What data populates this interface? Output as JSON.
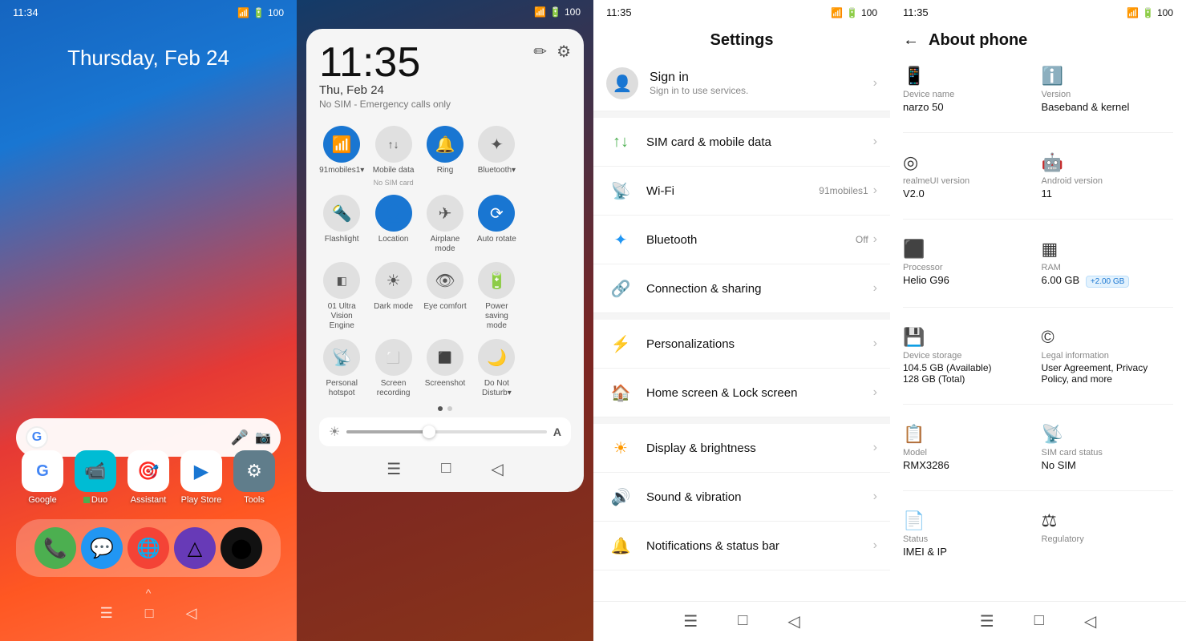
{
  "screen1": {
    "status_time": "11:34",
    "status_icons": "📶 🔋 100",
    "date": "Thursday, Feb 24",
    "apps": [
      {
        "label": "Google",
        "icon": "G",
        "bg": "#fff",
        "color": "#4285f4"
      },
      {
        "label": "Duo",
        "icon": "📹",
        "bg": "#00bcd4",
        "color": "white"
      },
      {
        "label": "Assistant",
        "icon": "◉",
        "bg": "#fff",
        "color": "#4285f4"
      },
      {
        "label": "Play Store",
        "icon": "▶",
        "bg": "#fff",
        "color": "#1976d2"
      },
      {
        "label": "Tools",
        "icon": "⚙",
        "bg": "#607d8b",
        "color": "white"
      }
    ],
    "dock": [
      {
        "icon": "📞",
        "bg": "#4caf50"
      },
      {
        "icon": "💬",
        "bg": "#2196f3"
      },
      {
        "icon": "🌐",
        "bg": "#f44336"
      },
      {
        "icon": "△",
        "bg": "#673ab7"
      },
      {
        "icon": "⬤",
        "bg": "#111"
      }
    ],
    "nav": [
      "☰",
      "□",
      "◁"
    ]
  },
  "screen2": {
    "status_time": "",
    "shade_time": "11:35",
    "shade_date": "Thu, Feb 24",
    "shade_sim": "No SIM - Emergency calls only",
    "tiles_row1": [
      {
        "label": "91mobiles1▾",
        "sublabel": "",
        "icon": "📶",
        "active": true
      },
      {
        "label": "Mobile data",
        "sublabel": "No SIM card",
        "icon": "↑↓",
        "active": false
      },
      {
        "label": "Ring",
        "sublabel": "",
        "icon": "🔔",
        "active": true
      },
      {
        "label": "Bluetooth▾",
        "sublabel": "",
        "icon": "✦",
        "active": false
      }
    ],
    "tiles_row2": [
      {
        "label": "Flashlight",
        "sublabel": "",
        "icon": "🔦",
        "active": false
      },
      {
        "label": "Location",
        "sublabel": "",
        "icon": "👤",
        "active": true
      },
      {
        "label": "Airplane mode",
        "sublabel": "",
        "icon": "✈",
        "active": false
      },
      {
        "label": "Auto rotate",
        "sublabel": "",
        "icon": "⟳",
        "active": true
      }
    ],
    "tiles_row3": [
      {
        "label": "01 Ultra Vision Engine",
        "sublabel": "",
        "icon": "◧",
        "active": false
      },
      {
        "label": "Dark mode",
        "sublabel": "",
        "icon": "☀",
        "active": false
      },
      {
        "label": "Eye comfort",
        "sublabel": "",
        "icon": "👁",
        "active": false
      },
      {
        "label": "Power saving mode",
        "sublabel": "",
        "icon": "🔋",
        "active": false
      }
    ],
    "tiles_row4": [
      {
        "label": "Personal hotspot",
        "sublabel": "",
        "icon": "📡",
        "active": false
      },
      {
        "label": "Screen recording",
        "sublabel": "",
        "icon": "⬜",
        "active": false
      },
      {
        "label": "Screenshot",
        "sublabel": "",
        "icon": "⬛",
        "active": false
      },
      {
        "label": "Do Not Disturb▾",
        "sublabel": "",
        "icon": "🌙",
        "active": false
      }
    ],
    "nav": [
      "☰",
      "□",
      "◁"
    ]
  },
  "screen3": {
    "status_time": "11:35",
    "title": "Settings",
    "items": [
      {
        "icon": "📶",
        "icon_color": "#4caf50",
        "title": "SIM card & mobile data",
        "sub": ""
      },
      {
        "icon": "📡",
        "icon_color": "#2196f3",
        "title": "Wi-Fi",
        "sub": "91mobiles1"
      },
      {
        "icon": "✦",
        "icon_color": "#2196f3",
        "title": "Bluetooth",
        "sub": "Off"
      },
      {
        "icon": "🔗",
        "icon_color": "#607d8b",
        "title": "Connection & sharing",
        "sub": ""
      },
      {
        "icon": "⚡",
        "icon_color": "#9c27b0",
        "title": "Personalizations",
        "sub": ""
      },
      {
        "icon": "🏠",
        "icon_color": "#ff5722",
        "title": "Home screen & Lock screen",
        "sub": ""
      },
      {
        "icon": "☀",
        "icon_color": "#ff9800",
        "title": "Display & brightness",
        "sub": ""
      },
      {
        "icon": "🔊",
        "icon_color": "#4caf50",
        "title": "Sound & vibration",
        "sub": ""
      },
      {
        "icon": "🔔",
        "icon_color": "#2196f3",
        "title": "Notifications & status bar",
        "sub": ""
      }
    ],
    "nav": [
      "☰",
      "□",
      "◁"
    ]
  },
  "screen4": {
    "status_time": "11:35",
    "back_label": "←",
    "title": "About phone",
    "items": [
      {
        "icon": "📱",
        "label": "Device name",
        "value": "narzo 50"
      },
      {
        "icon": "ℹ",
        "label": "Version",
        "value": "Baseband & kernel"
      },
      {
        "icon": "◎",
        "label": "realmeUI version",
        "value": "V2.0"
      },
      {
        "icon": "🤖",
        "label": "Android version",
        "value": "11"
      },
      {
        "icon": "⬛",
        "label": "Processor",
        "value": "Helio G96"
      },
      {
        "icon": "▦",
        "label": "RAM",
        "value": "6.00 GB",
        "badge": "+2.00 GB"
      },
      {
        "icon": "💾",
        "label": "Device storage",
        "value": "104.5 GB (Available)\n128 GB (Total)"
      },
      {
        "icon": "©",
        "label": "Legal information",
        "value": "User Agreement, Privacy Policy, and more"
      },
      {
        "icon": "📋",
        "label": "Model",
        "value": "RMX3286"
      },
      {
        "icon": "📡",
        "label": "SIM card status",
        "value": "No SIM"
      },
      {
        "icon": "📄",
        "label": "Status",
        "value": "IMEI & IP"
      },
      {
        "icon": "⚖",
        "label": "Regulatory",
        "value": ""
      }
    ],
    "nav": [
      "☰",
      "□",
      "◁"
    ]
  }
}
